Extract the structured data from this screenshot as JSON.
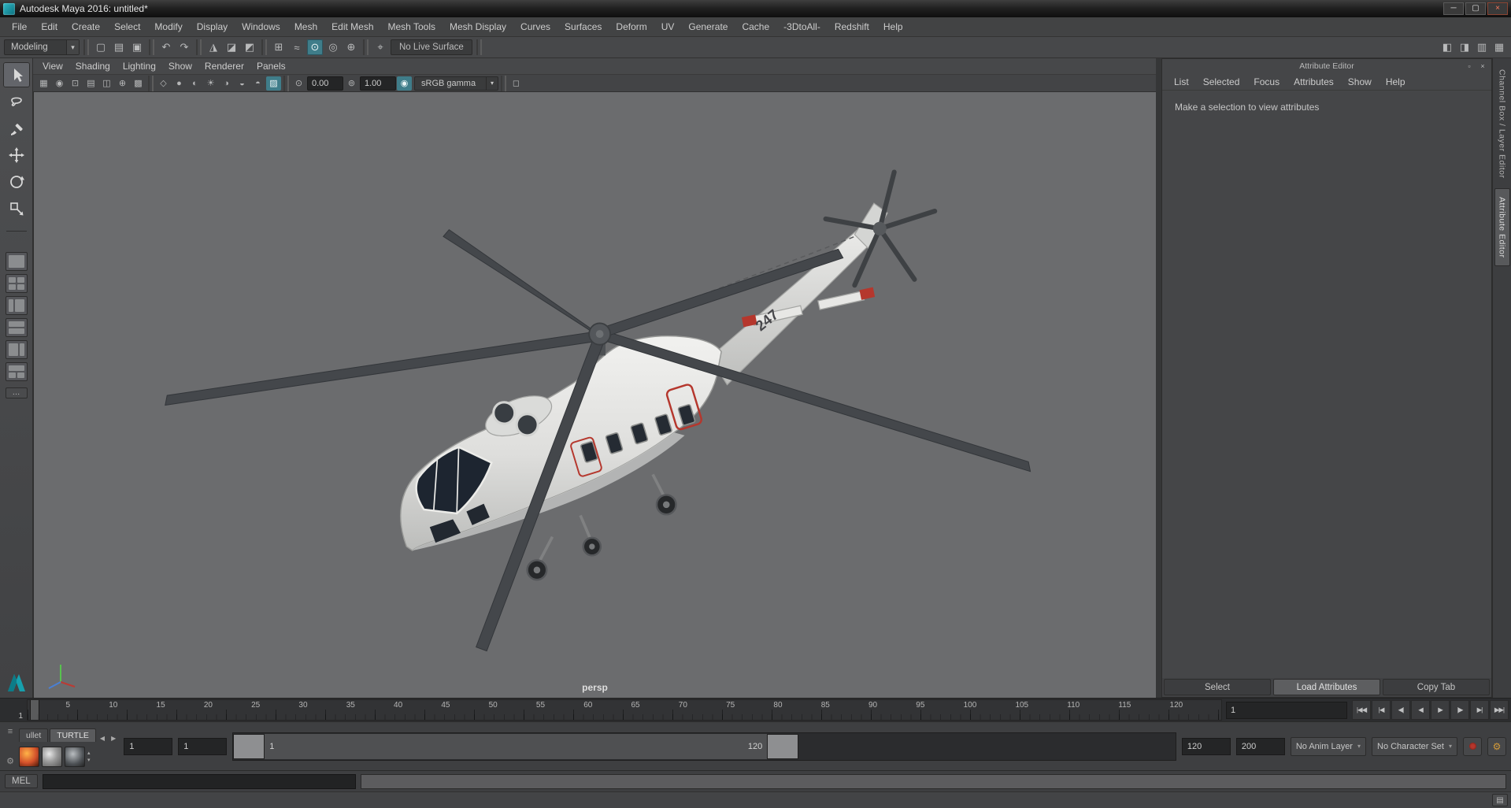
{
  "window": {
    "title": "Autodesk Maya 2016: untitled*",
    "controls": {
      "minimize": "─",
      "maximize": "▢",
      "close": "×"
    }
  },
  "menubar": {
    "items": [
      "File",
      "Edit",
      "Create",
      "Select",
      "Modify",
      "Display",
      "Windows",
      "Mesh",
      "Edit Mesh",
      "Mesh Tools",
      "Mesh Display",
      "Curves",
      "Surfaces",
      "Deform",
      "UV",
      "Generate",
      "Cache",
      "-3DtoAll-",
      "Redshift",
      "Help"
    ]
  },
  "statusline": {
    "menuset": "Modeling",
    "live_surface": "No Live Surface",
    "icons": {
      "new_scene": "▢",
      "open_scene": "▤",
      "save_scene": "▣",
      "undo": "↶",
      "redo": "↷",
      "select_hierarchy": "◮",
      "select_object": "◪",
      "select_component": "◩",
      "snap_grid": "⊞",
      "snap_curve": "≈",
      "snap_point": "⊙",
      "snap_projected": "◎",
      "snap_view_plane": "⊕",
      "make_live": "⌖"
    },
    "right_icons": {
      "modeling_toolkit": "◧",
      "attribute_editor": "◨",
      "tool_settings": "▥",
      "channel_box": "▦"
    }
  },
  "toolbox": {
    "tools": [
      "Select Tool",
      "Lasso Tool",
      "Paint Selection Tool",
      "Move Tool",
      "Rotate Tool",
      "Scale Tool"
    ],
    "layouts": [
      "Single Pane Layout",
      "Four View Layout",
      "Persp/Outliner Layout",
      "Persp/Graph Layout",
      "Hypershade/Persp Layout",
      "Persp/UV Layout"
    ],
    "more": "…"
  },
  "panel_menu": {
    "items": [
      "View",
      "Shading",
      "Lighting",
      "Show",
      "Renderer",
      "Panels"
    ]
  },
  "panel_toolbar": {
    "exposure": "0.00",
    "gamma": "1.00",
    "view_transform": "sRGB gamma",
    "icons": {
      "select_camera": "▦",
      "lock_camera": "◉",
      "camera_attributes": "⊡",
      "bookmarks": "▤",
      "image_plane": "◫",
      "pan_zoom": "⊕",
      "oversampling": "▩",
      "wireframe": "◇",
      "smooth_shade": "●",
      "textured": "◐",
      "lights": "☀",
      "shadows": "◑",
      "ssao": "◒",
      "motion_blur": "◓",
      "multisample": "▨",
      "exposure_toggle": "⊙",
      "gamma_toggle": "⊚",
      "view_transform_enabled": "◉",
      "isolate_select": "◻"
    }
  },
  "viewport": {
    "camera_label": "persp",
    "tail_number": "247"
  },
  "attribute_editor": {
    "title": "Attribute Editor",
    "menu": [
      "List",
      "Selected",
      "Focus",
      "Attributes",
      "Show",
      "Help"
    ],
    "message": "Make a selection to view attributes",
    "buttons": [
      "Select",
      "Load Attributes",
      "Copy Tab"
    ]
  },
  "right_tabs": [
    "Channel Box / Layer Editor",
    "Attribute Editor"
  ],
  "timeline": {
    "current_frame": "1",
    "ticks": [
      "5",
      "10",
      "15",
      "20",
      "25",
      "30",
      "35",
      "40",
      "45",
      "50",
      "55",
      "60",
      "65",
      "70",
      "75",
      "80",
      "85",
      "90",
      "95",
      "100",
      "105",
      "110",
      "115",
      "120"
    ],
    "playback": {
      "go_to_start": "|◀◀",
      "step_back_key": "|◀",
      "step_back_frame": "◀|",
      "play_backwards": "◀",
      "play_forwards": "▶",
      "step_forward_frame": "|▶",
      "step_forward_key": "▶|",
      "go_to_end": "▶▶|"
    }
  },
  "range_slider": {
    "anim_start": "1",
    "playback_start": "1",
    "range_start_label": "1",
    "range_end_label": "120",
    "playback_end": "120",
    "anim_end": "200",
    "anim_layer": "No Anim Layer",
    "character_set": "No Character Set"
  },
  "shelf": {
    "tabs": [
      "ullet",
      "TURTLE"
    ],
    "prev": "◀",
    "next": "▶"
  },
  "command_line": {
    "label": "MEL"
  },
  "misc_icons": {
    "grip": "≡",
    "gear": "⚙",
    "stepper_up": "▴",
    "stepper_down": "▾",
    "dropdown_arrow": "▾",
    "script_editor": "▤",
    "dock": "▫",
    "close": "×"
  },
  "colors": {
    "viewport_bg": "#6b6c6e",
    "ui_bg": "#454648",
    "accent_teal": "#3f7d8a",
    "accent_red": "#b5372d"
  }
}
